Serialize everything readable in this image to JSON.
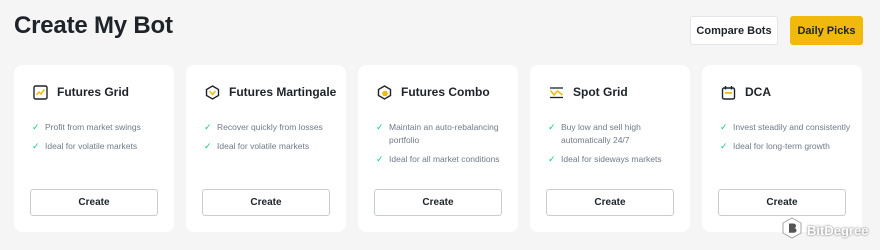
{
  "header": {
    "title": "Create My Bot",
    "compare_label": "Compare Bots",
    "picks_label": "Daily Picks"
  },
  "colors": {
    "accent": "#f0b90b",
    "check": "#0ecb81",
    "text": "#1e2329",
    "muted": "#707a8a"
  },
  "cards": [
    {
      "title": "Futures Grid",
      "icon": "futures-grid-icon",
      "features": [
        "Profit from market swings",
        "Ideal for volatile markets"
      ],
      "create_label": "Create"
    },
    {
      "title": "Futures Martingale",
      "icon": "futures-martingale-icon",
      "features": [
        "Recover quickly from losses",
        "Ideal for volatile markets"
      ],
      "create_label": "Create"
    },
    {
      "title": "Futures Combo",
      "icon": "futures-combo-icon",
      "features": [
        "Maintain an auto-rebalancing portfolio",
        "Ideal for all market conditions"
      ],
      "create_label": "Create"
    },
    {
      "title": "Spot Grid",
      "icon": "spot-grid-icon",
      "features": [
        "Buy low and sell high automatically 24/7",
        "Ideal for sideways markets"
      ],
      "create_label": "Create"
    },
    {
      "title": "DCA",
      "icon": "calendar-icon",
      "features": [
        "Invest steadily and consistently",
        "Ideal for long-term growth"
      ],
      "create_label": "Create"
    }
  ],
  "watermark": {
    "text": "BitDegree"
  }
}
